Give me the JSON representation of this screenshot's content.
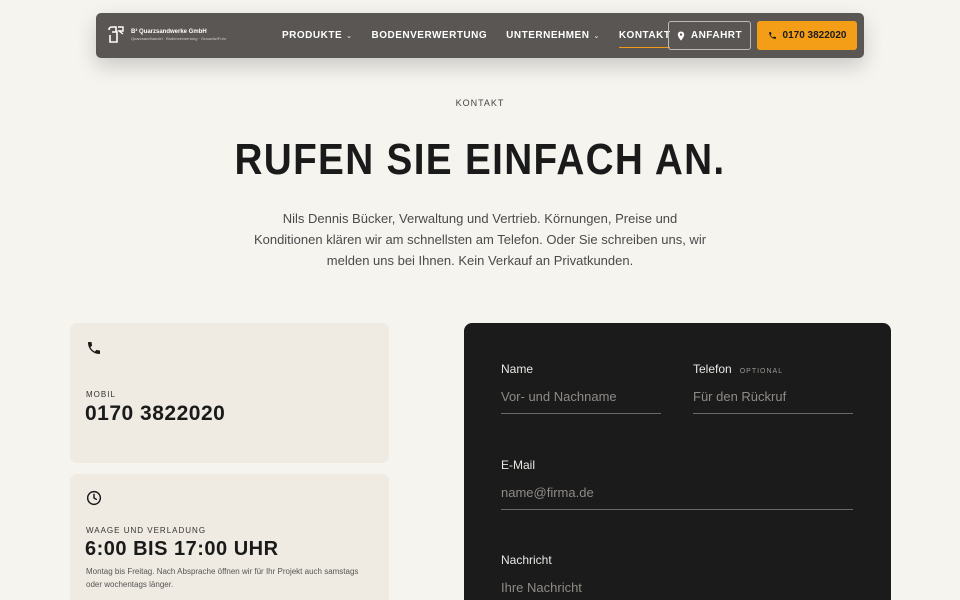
{
  "nav": {
    "logo_name": "B² Quarzsandwerke GmbH",
    "logo_tagline": "Quarzsandhandel · Bodenverwertung · Grauwitz/Fuhr",
    "items": [
      {
        "label": "PRODUKTE",
        "has_dropdown": true
      },
      {
        "label": "BODENVERWERTUNG",
        "has_dropdown": false
      },
      {
        "label": "UNTERNEHMEN",
        "has_dropdown": true
      },
      {
        "label": "KONTAKT",
        "has_dropdown": false,
        "active": true
      }
    ],
    "directions_label": "ANFAHRT",
    "phone_label": "0170 3822020"
  },
  "hero": {
    "eyebrow": "KONTAKT",
    "headline": "RUFEN SIE EINFACH AN.",
    "intro": "Nils Dennis Bücker, Verwaltung und Vertrieb. Körnungen, Preise und Konditionen klären wir am schnellsten am Telefon. Oder Sie schreiben uns, wir melden uns bei Ihnen. Kein Verkauf an Privatkunden."
  },
  "cards": {
    "phone": {
      "icon": "phone-icon",
      "label": "MOBIL",
      "value": "0170 3822020"
    },
    "hours": {
      "icon": "clock-icon",
      "label": "WAAGE UND VERLADUNG",
      "value": "6:00 BIS 17:00 UHR",
      "note": "Montag bis Freitag. Nach Absprache öffnen wir für Ihr Projekt auch samstags oder wochentags länger."
    }
  },
  "form": {
    "name": {
      "label": "Name",
      "placeholder": "Vor- und Nachname"
    },
    "phone": {
      "label": "Telefon",
      "optional": "OPTIONAL",
      "placeholder": "Für den Rückruf"
    },
    "email": {
      "label": "E-Mail",
      "placeholder": "name@firma.de"
    },
    "message": {
      "label": "Nachricht",
      "placeholder": "Ihre Nachricht"
    }
  },
  "colors": {
    "accent": "#f49d17",
    "nav_bg": "#595653",
    "page_bg": "#f6f4ef",
    "card_bg": "#efebe2",
    "form_bg": "#1b1b1b"
  }
}
